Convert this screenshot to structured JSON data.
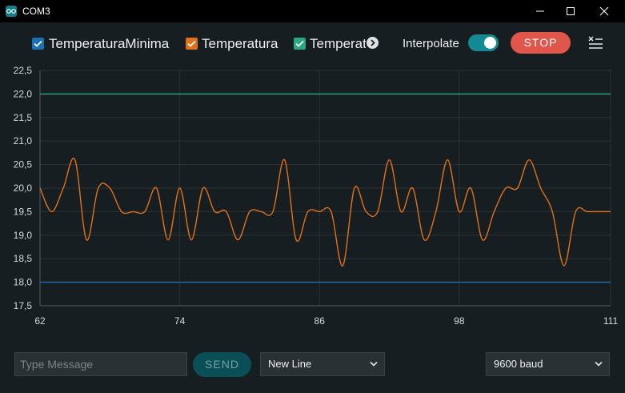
{
  "window": {
    "title": "COM3"
  },
  "legend": [
    {
      "label": "TemperaturaMinima",
      "color": "#1a6fb5"
    },
    {
      "label": "Temperatura",
      "color": "#e0701a"
    },
    {
      "label": "Temperat",
      "color": "#2aa87e"
    }
  ],
  "toolbar": {
    "interpolate_label": "Interpolate",
    "interpolate_on": true,
    "stop_label": "STOP"
  },
  "chart_data": {
    "type": "line",
    "x_ticks": [
      "62",
      "74",
      "86",
      "98",
      "111"
    ],
    "y_ticks": [
      "22,5",
      "22,0",
      "21,5",
      "21,0",
      "20,5",
      "20,0",
      "19,5",
      "19,0",
      "18,5",
      "18,0",
      "17,5"
    ],
    "xlim": [
      62,
      111
    ],
    "ylim": [
      17.5,
      22.5
    ],
    "grid": true,
    "series": [
      {
        "name": "TemperaturaMinima",
        "color": "#1a6fb5",
        "x": [
          62,
          111
        ],
        "y": [
          18.0,
          18.0
        ]
      },
      {
        "name": "Temperatura",
        "color": "#e0701a",
        "x": [
          62,
          63,
          64,
          65,
          66,
          67,
          68,
          69,
          70,
          71,
          72,
          73,
          74,
          75,
          76,
          77,
          78,
          79,
          80,
          81,
          82,
          83,
          84,
          85,
          86,
          87,
          88,
          89,
          90,
          91,
          92,
          93,
          94,
          95,
          96,
          97,
          98,
          99,
          100,
          101,
          102,
          103,
          104,
          105,
          106,
          107,
          108,
          109,
          110,
          111
        ],
        "y": [
          20.0,
          19.5,
          20.0,
          20.6,
          18.9,
          20.0,
          20.0,
          19.5,
          19.5,
          19.5,
          20.0,
          18.9,
          20.0,
          18.9,
          20.0,
          19.5,
          19.5,
          18.9,
          19.5,
          19.5,
          19.5,
          20.6,
          18.9,
          19.5,
          19.5,
          19.5,
          18.35,
          20.0,
          19.5,
          19.5,
          20.6,
          19.5,
          20.0,
          18.9,
          19.5,
          20.6,
          19.5,
          20.0,
          18.9,
          19.5,
          20.0,
          20.0,
          20.6,
          20.0,
          19.5,
          18.35,
          19.5,
          19.5,
          19.5,
          19.5
        ]
      },
      {
        "name": "Temperat",
        "color": "#2aa87e",
        "x": [
          62,
          111
        ],
        "y": [
          22.0,
          22.0
        ]
      }
    ]
  },
  "bottom": {
    "message_placeholder": "Type Message",
    "send_label": "SEND",
    "line_ending": "New Line",
    "baud": "9600 baud"
  }
}
